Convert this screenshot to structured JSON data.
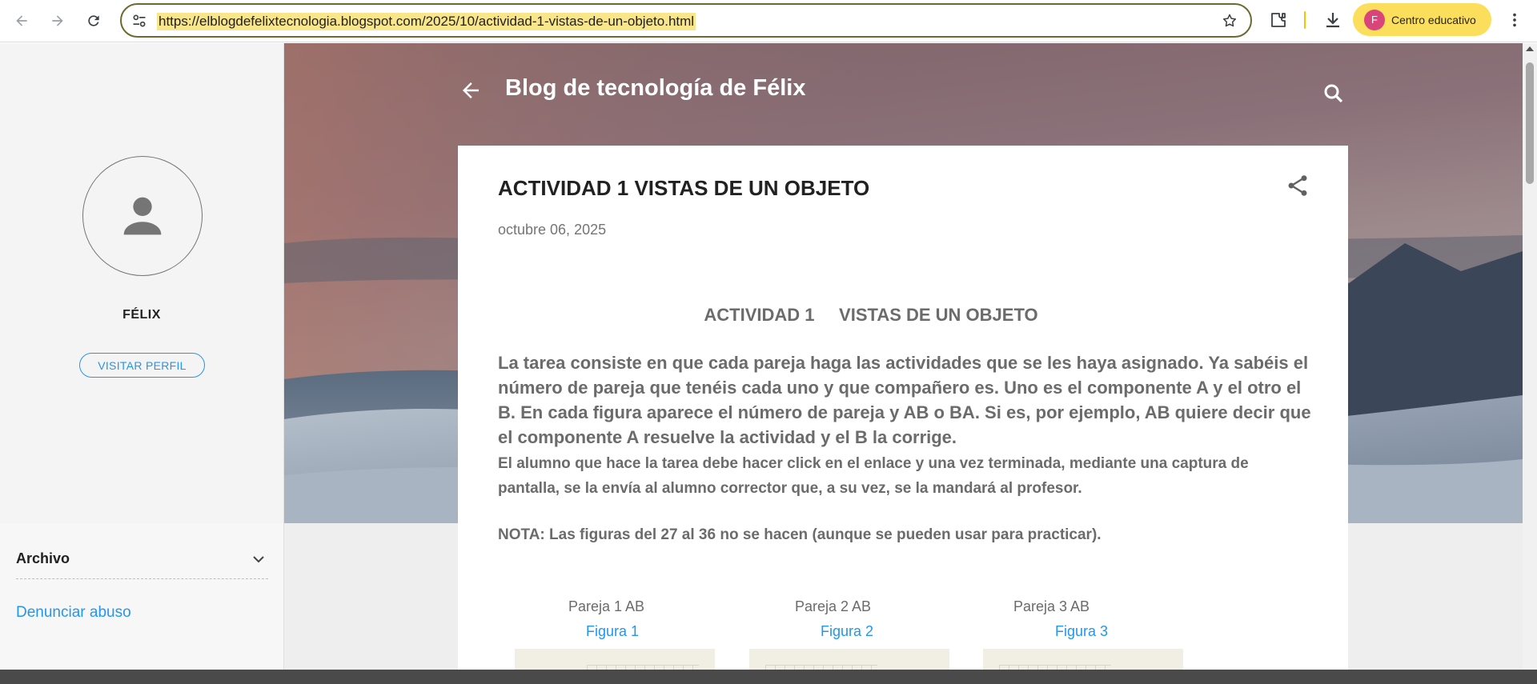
{
  "browser": {
    "url": "https://elblogdefelixtecnologia.blogspot.com/2025/10/actividad-1-vistas-de-un-objeto.html",
    "profile_initial": "F",
    "profile_label": "Centro educativo",
    "accent_color": "#fbdf5c"
  },
  "sidebar": {
    "profile_name": "FÉLIX",
    "visit_profile_label": "VISITAR PERFIL",
    "archive_label": "Archivo",
    "report_abuse_label": "Denunciar abuso"
  },
  "blog": {
    "title": "Blog de tecnología de Félix"
  },
  "post": {
    "title": "ACTIVIDAD 1 VISTAS DE UN OBJETO",
    "date": "octubre 06, 2025",
    "heading": "ACTIVIDAD 1     VISTAS DE UN OBJETO",
    "paragraph1": "La tarea consiste en que cada pareja haga las actividades que se les haya asignado. Ya sabéis el número de pareja que tenéis cada uno y que compañero es. Uno es el componente A y el otro el B. En cada figura aparece el número de pareja y AB o BA. Si es, por ejemplo, AB quiere decir que el componente A resuelve la actividad y el B la corrige.",
    "paragraph2": "El alumno que hace la tarea debe hacer click en el enlace y una vez terminada, mediante una captura de pantalla, se la envía al alumno corrector que, a su vez, se la mandará al profesor.",
    "note": "NOTA: Las figuras del 27 al 36 no se hacen (aunque se pueden usar para practicar).",
    "figures": [
      {
        "pair": "Pareja 1 AB",
        "link": "Figura 1"
      },
      {
        "pair": "Pareja 2 AB",
        "link": "Figura 2"
      },
      {
        "pair": "Pareja 3 AB",
        "link": "Figura 3"
      }
    ]
  },
  "icons": [
    "back-icon",
    "forward-icon",
    "reload-icon",
    "site-info-icon",
    "bookmark-star-icon",
    "extensions-icon",
    "download-icon",
    "menu-kebab-icon",
    "person-icon",
    "chevron-down-icon",
    "arrow-back-icon",
    "search-icon",
    "share-icon"
  ]
}
